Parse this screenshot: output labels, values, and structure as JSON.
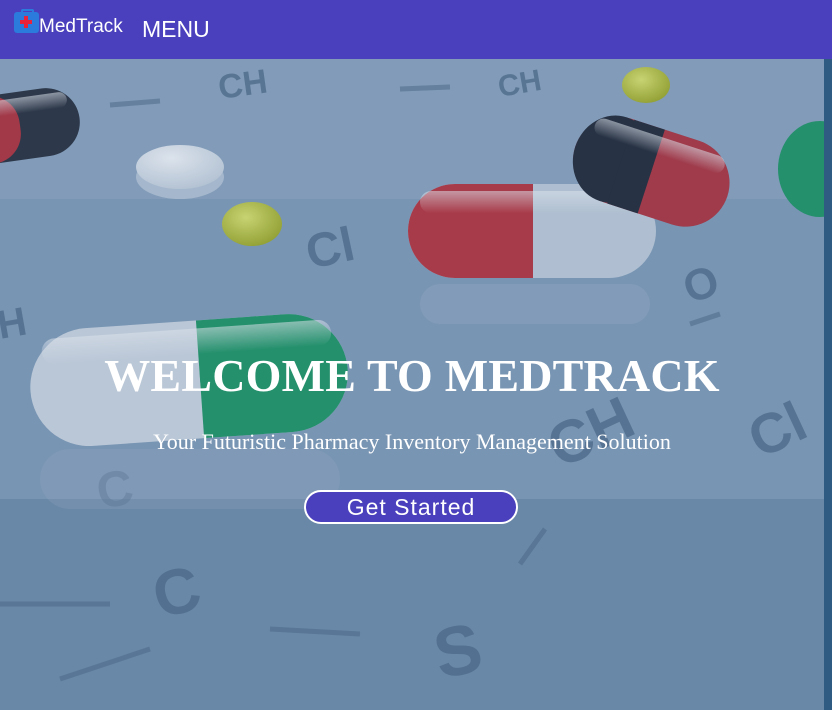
{
  "navbar": {
    "logo_icon": "medical-kit-icon",
    "brand": "MedTrack",
    "menu_label": "MENU"
  },
  "hero": {
    "title": "WELCOME TO MEDTRACK",
    "subtitle": "Your Futuristic Pharmacy Inventory Management Solution",
    "cta_label": "Get Started"
  },
  "colors": {
    "navbar_bg": "#4a40bd",
    "button_bg": "#4a40bd",
    "text": "#ffffff",
    "capsule_red": "#c0333a",
    "capsule_green": "#1f9a63"
  }
}
